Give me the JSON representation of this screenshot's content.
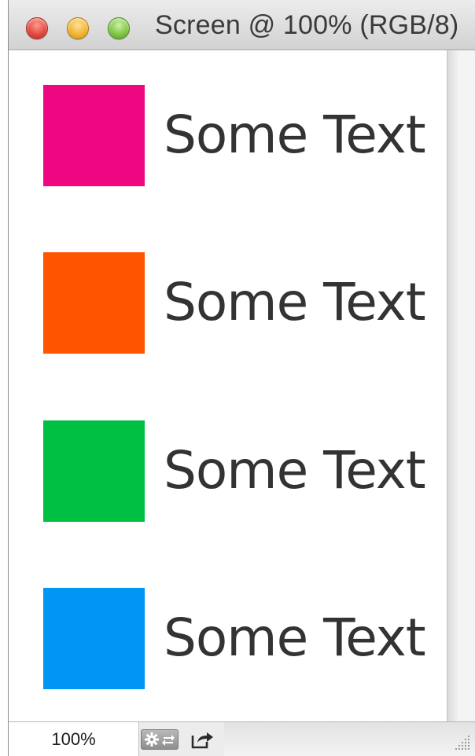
{
  "window": {
    "title": "Screen @ 100% (RGB/8)"
  },
  "rows": [
    {
      "label": "Some Text",
      "color": "#ee0780"
    },
    {
      "label": "Some Text",
      "color": "#ff5400"
    },
    {
      "label": "Some Text",
      "color": "#00c043"
    },
    {
      "label": "Some Text",
      "color": "#0096f4"
    }
  ],
  "status": {
    "zoom": "100%",
    "icons": [
      "gear-arrows-icon",
      "share-icon",
      "resize-grip-icon"
    ]
  }
}
